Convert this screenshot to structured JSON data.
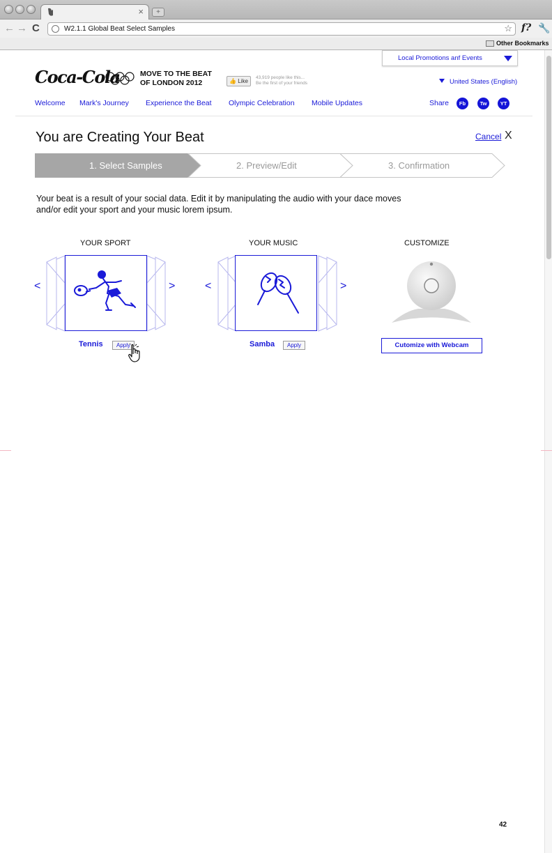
{
  "browser": {
    "tab_title": "",
    "address": "W2.1.1 Global Beat Select Samples",
    "bookmarks_label": "Other Bookmarks",
    "new_tab_glyph": "+",
    "tab_close_glyph": "×",
    "back_icon": "arrow-left-icon",
    "forward_icon": "arrow-right-icon",
    "reload_icon": "reload-icon",
    "star_icon": "star-icon",
    "wrench_icon": "wrench-icon",
    "f_glyph": "f?"
  },
  "header": {
    "promo_dropdown": "Local Promotions anf Events",
    "logo_text": "Coca-Cola",
    "tagline_line1": "MOVE TO THE BEAT",
    "tagline_line2": "OF LONDON 2012",
    "like_label": "Like",
    "like_count": "43,919 people like this...",
    "like_friends": "Be the first of your friends",
    "locale": "United States (English)"
  },
  "nav": {
    "items": [
      {
        "label": "Welcome"
      },
      {
        "label": "Mark's Journey"
      },
      {
        "label": "Experience the Beat"
      },
      {
        "label": "Olympic Celebration"
      },
      {
        "label": "Mobile Updates"
      }
    ],
    "share_label": "Share",
    "social": [
      {
        "label": "Fb"
      },
      {
        "label": "Tw"
      },
      {
        "label": "YT"
      }
    ]
  },
  "main": {
    "title": "You are Creating Your Beat",
    "cancel_label": "Cancel",
    "close_glyph": "X",
    "steps": [
      {
        "label": "1. Select Samples",
        "active": true
      },
      {
        "label": "2. Preview/Edit",
        "active": false
      },
      {
        "label": "3. Confirmation",
        "active": false
      }
    ],
    "intro_line1": "Your beat is a result of your social data. Edit it by manipulating the audio with your dace moves",
    "intro_line2": "and/or edit your sport and your music lorem ipsum.",
    "sport": {
      "heading": "YOUR SPORT",
      "item": "Tennis",
      "apply_label": "Apply"
    },
    "music": {
      "heading": "YOUR MUSIC",
      "item": "Samba",
      "apply_label": "Apply"
    },
    "customize": {
      "heading": "CUSTOMIZE",
      "button_label": "Cutomize with Webcam"
    },
    "prev_glyph": "<",
    "next_glyph": ">"
  },
  "page_number": "42",
  "colors": {
    "link_blue": "#1a1ad8",
    "active_step": "#a6a6a6",
    "inactive_step_text": "#9a9a9a"
  }
}
